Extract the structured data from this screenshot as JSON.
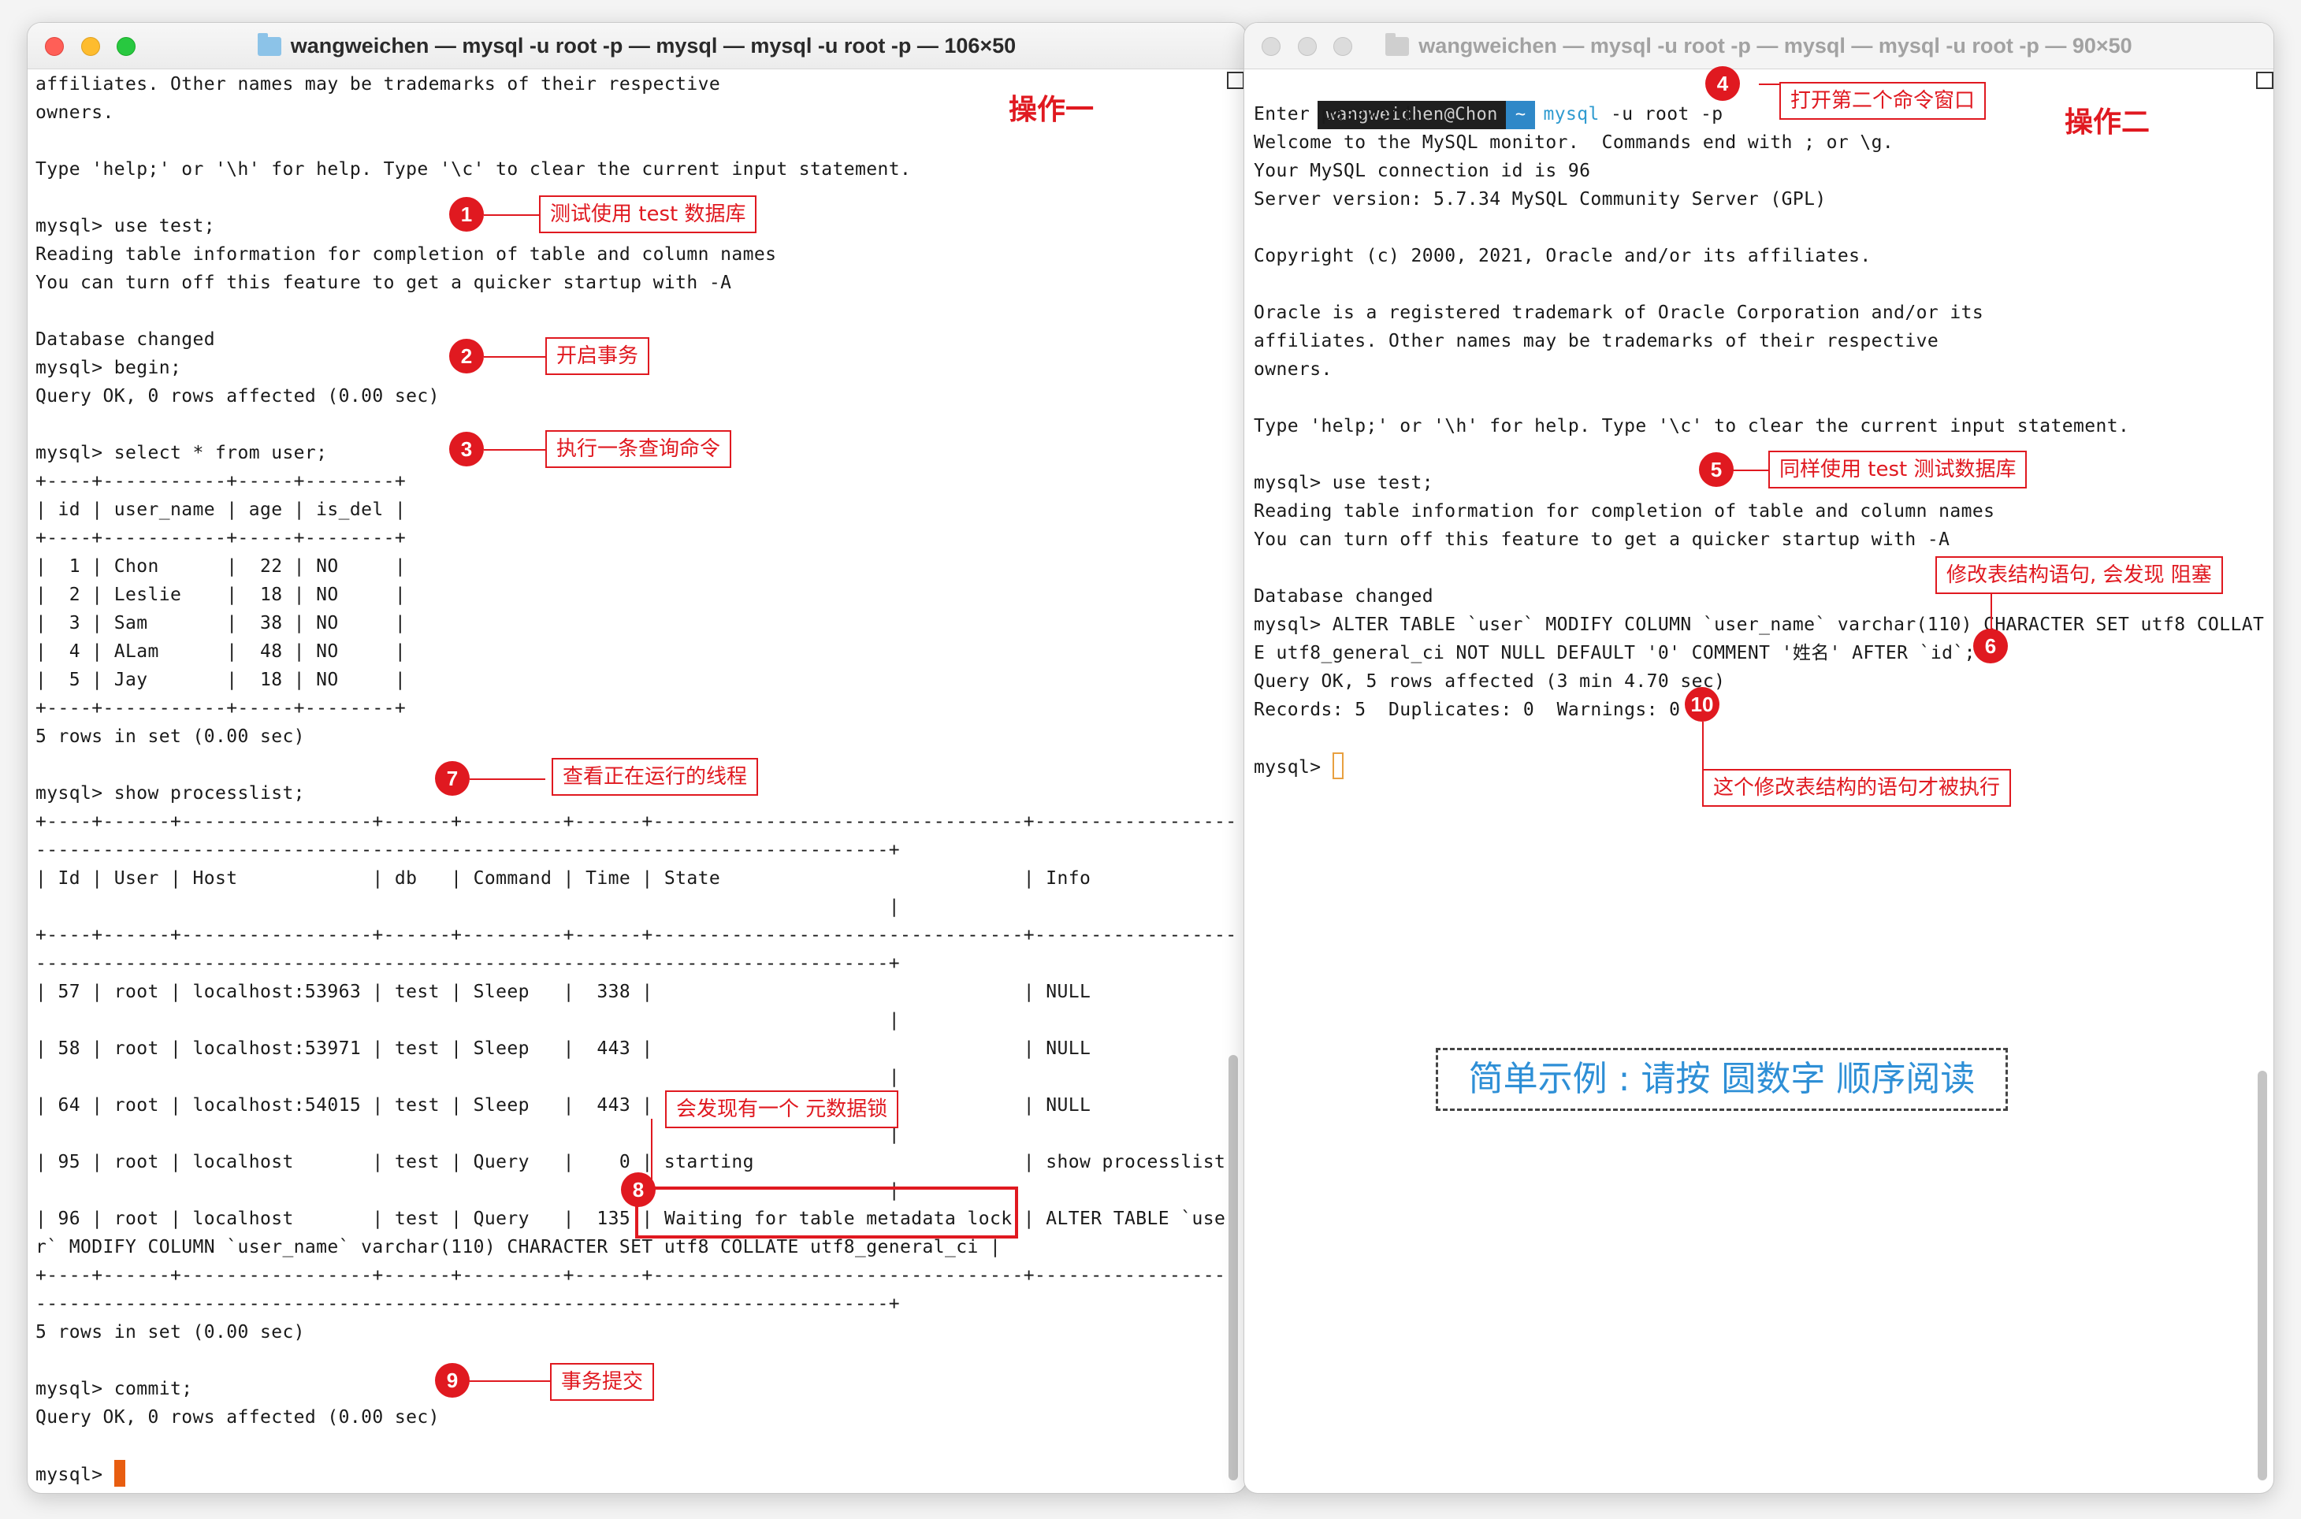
{
  "left_window": {
    "title": "wangweichen — mysql -u root -p — mysql — mysql -u root -p — 106×50",
    "op_title": "操作一",
    "lines": [
      "affiliates. Other names may be trademarks of their respective",
      "owners.",
      "",
      "Type 'help;' or '\\h' for help. Type '\\c' to clear the current input statement.",
      "",
      "mysql> use test;",
      "Reading table information for completion of table and column names",
      "You can turn off this feature to get a quicker startup with -A",
      "",
      "Database changed",
      "mysql> begin;",
      "Query OK, 0 rows affected (0.00 sec)",
      "",
      "mysql> select * from user;",
      "+----+-----------+-----+--------+",
      "| id | user_name | age | is_del |",
      "+----+-----------+-----+--------+",
      "|  1 | Chon      |  22 | NO     |",
      "|  2 | Leslie    |  18 | NO     |",
      "|  3 | Sam       |  38 | NO     |",
      "|  4 | ALam      |  48 | NO     |",
      "|  5 | Jay       |  18 | NO     |",
      "+----+-----------+-----+--------+",
      "5 rows in set (0.00 sec)",
      "",
      "mysql> show processlist;",
      "+----+------+-----------------+------+---------+------+---------------------------------+------------------",
      "----------------------------------------------------------------------------+",
      "| Id | User | Host            | db   | Command | Time | State                           | Info",
      "                                                                            |",
      "+----+------+-----------------+------+---------+------+---------------------------------+------------------",
      "----------------------------------------------------------------------------+",
      "| 57 | root | localhost:53963 | test | Sleep   |  338 |                                 | NULL",
      "                                                                            |",
      "| 58 | root | localhost:53971 | test | Sleep   |  443 |                                 | NULL",
      "                                                                            |",
      "| 64 | root | localhost:54015 | test | Sleep   |  443 |                                 | NULL",
      "                                                                            |",
      "| 95 | root | localhost       | test | Query   |    0 | starting                        | show processlist",
      "                                                                            |",
      "| 96 | root | localhost       | test | Query   |  135 | Waiting for table metadata lock | ALTER TABLE `use",
      "r` MODIFY COLUMN `user_name` varchar(110) CHARACTER SET utf8 COLLATE utf8_general_ci |",
      "+----+------+-----------------+------+---------+------+---------------------------------+------------------",
      "----------------------------------------------------------------------------+",
      "5 rows in set (0.00 sec)",
      "",
      "mysql> commit;",
      "Query OK, 0 rows affected (0.00 sec)",
      "",
      "mysql> "
    ]
  },
  "right_window": {
    "title": "wangweichen — mysql -u root -p — mysql — mysql -u root -p — 90×50",
    "op_title": "操作二",
    "prompt_user": "wangweichen@Chon",
    "prompt_dir": "~",
    "prompt_bin": "mysql",
    "prompt_args": " -u root -p",
    "lines": [
      "Enter password:",
      "Welcome to the MySQL monitor.  Commands end with ; or \\g.",
      "Your MySQL connection id is 96",
      "Server version: 5.7.34 MySQL Community Server (GPL)",
      "",
      "Copyright (c) 2000, 2021, Oracle and/or its affiliates.",
      "",
      "Oracle is a registered trademark of Oracle Corporation and/or its",
      "affiliates. Other names may be trademarks of their respective",
      "owners.",
      "",
      "Type 'help;' or '\\h' for help. Type '\\c' to clear the current input statement.",
      "",
      "mysql> use test;",
      "Reading table information for completion of table and column names",
      "You can turn off this feature to get a quicker startup with -A",
      "",
      "Database changed",
      "mysql> ALTER TABLE `user` MODIFY COLUMN `user_name` varchar(110) CHARACTER SET utf8 COLLAT",
      "E utf8_general_ci NOT NULL DEFAULT '0' COMMENT '姓名' AFTER `id`;",
      "Query OK, 5 rows affected (3 min 4.70 sec)",
      "Records: 5  Duplicates: 0  Warnings: 0",
      "",
      "mysql> "
    ]
  },
  "annotations": [
    {
      "num": "1",
      "text": "测试使用 test 数据库"
    },
    {
      "num": "2",
      "text": "开启事务"
    },
    {
      "num": "3",
      "text": "执行一条查询命令"
    },
    {
      "num": "4",
      "text": "打开第二个命令窗口"
    },
    {
      "num": "5",
      "text": "同样使用 test 测试数据库"
    },
    {
      "num": "6",
      "text": "修改表结构语句, 会发现 阻塞"
    },
    {
      "num": "7",
      "text": "查看正在运行的线程"
    },
    {
      "num": "8",
      "text": "会发现有一个 元数据锁"
    },
    {
      "num": "9",
      "text": "事务提交"
    },
    {
      "num": "10",
      "text": "这个修改表结构的语句才被执行"
    }
  ],
  "note": "简单示例 : 请按 圆数字 顺序阅读",
  "colors": {
    "annotation": "#e01920",
    "note_text": "#2e8fd6",
    "cursor": "#e85d10"
  }
}
